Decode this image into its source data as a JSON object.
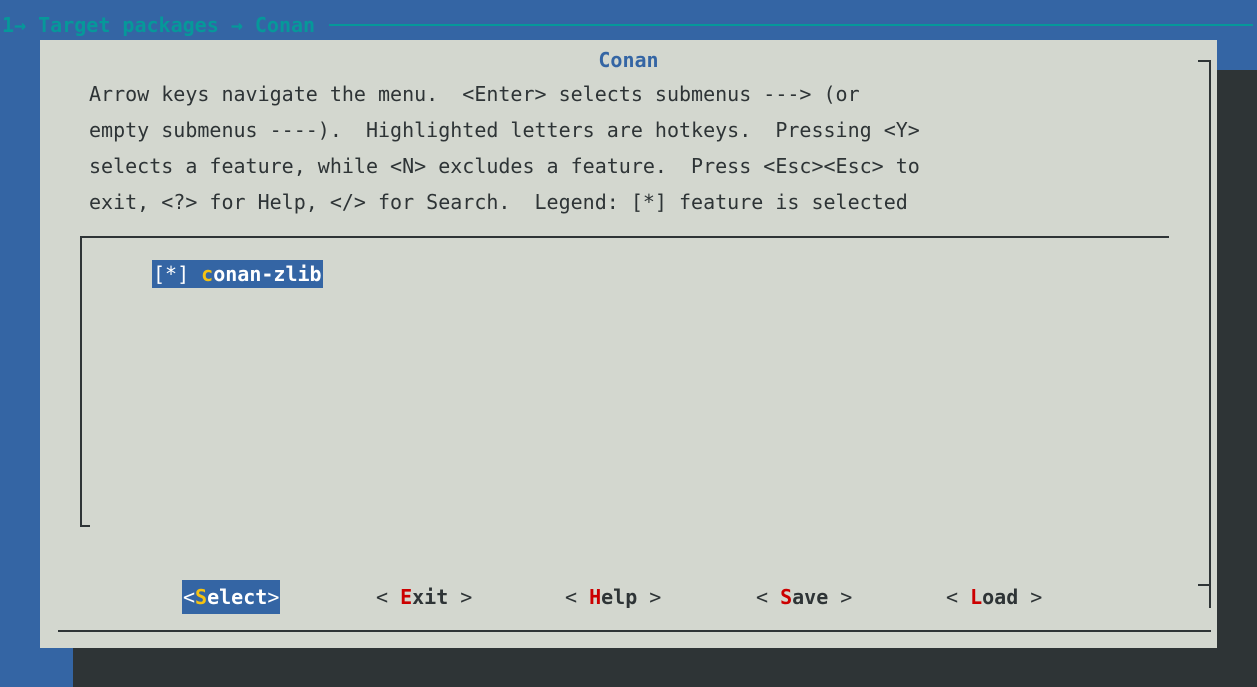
{
  "backtitle": {
    "breadcrumb": "1→ Target packages → Conan"
  },
  "dialog": {
    "title": "Conan",
    "help_lines": [
      "Arrow keys navigate the menu.  <Enter> selects submenus ---> (or",
      "empty submenus ----).  Highlighted letters are hotkeys.  Pressing <Y>",
      "selects a feature, while <N> excludes a feature.  Press <Esc><Esc> to",
      "exit, <?> for Help, </> for Search.  Legend: [*] feature is selected"
    ]
  },
  "menu": {
    "items": [
      {
        "checkbox": "[*]",
        "hotkey": "c",
        "label_rest": "onan-zlib",
        "label": "conan-zlib",
        "selected": true,
        "highlighted": true
      }
    ]
  },
  "buttons": {
    "select": {
      "open": "<",
      "hotkey": "S",
      "rest": "elect",
      "close": ">"
    },
    "exit": {
      "open": "< ",
      "hotkey": "E",
      "rest": "xit",
      "close": " >"
    },
    "help": {
      "open": "< ",
      "hotkey": "H",
      "rest": "elp",
      "close": " >"
    },
    "save": {
      "open": "< ",
      "hotkey": "S",
      "rest": "ave",
      "close": " >"
    },
    "load": {
      "open": "< ",
      "hotkey": "L",
      "rest": "oad",
      "close": " >"
    }
  },
  "colors": {
    "screen_background": "#3465a4",
    "dialog_background": "#d3d7cf",
    "shadow": "#2e3436",
    "title": "#3465a4",
    "backtitle": "#06989a",
    "highlight_background": "#3465a4",
    "hotkey_selected": "#f5c211",
    "hotkey_unselected": "#cc0000"
  }
}
